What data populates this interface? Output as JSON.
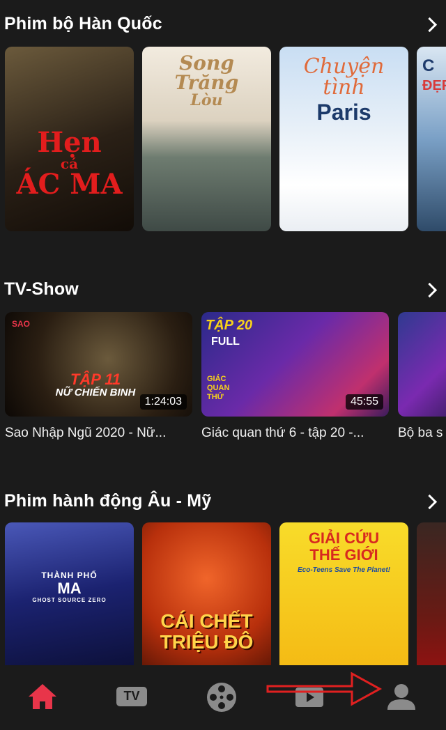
{
  "sections": [
    {
      "title": "Phim bộ Hàn Quốc",
      "cards": [
        {
          "overlay": [
            "Hẹn",
            "cá",
            "ÁC MA"
          ],
          "colors": [
            "#5a4a32",
            "#1d150d"
          ]
        },
        {
          "overlay": [
            "Song",
            "Trăng",
            "Lòu"
          ],
          "colors": [
            "#efe6d6",
            "#6f7d74"
          ]
        },
        {
          "overlay": [
            "Chuyện tình",
            "Paris"
          ],
          "colors": [
            "#cfe2f5",
            "#f2f5fb"
          ]
        },
        {
          "overlay": [
            "C",
            "ĐẸP"
          ],
          "colors": [
            "#7fa3c6",
            "#3c5a78"
          ]
        }
      ]
    },
    {
      "title": "TV-Show",
      "items": [
        {
          "duration": "1:24:03",
          "caption": "Sao Nhập Ngũ 2020 - Nữ...",
          "badge": "SAO",
          "overlay": [
            "TẬP 11",
            "NỮ CHIẾN BINH"
          ],
          "colors": [
            "#3a2d1f",
            "#120c08"
          ]
        },
        {
          "duration": "45:55",
          "caption": "Giác quan thứ 6 - tập 20 -...",
          "badge": "TẬP 20",
          "overlay": [
            "FULL",
            "GIÁC QUAN THỨ"
          ],
          "colors": [
            "#3d2a86",
            "#b0226e"
          ]
        },
        {
          "duration": "",
          "caption": "Bộ ba s",
          "badge": "",
          "overlay": [],
          "colors": [
            "#3b2f7a",
            "#6c2aa0"
          ]
        }
      ]
    },
    {
      "title": "Phim hành động Âu - Mỹ",
      "cards": [
        {
          "overlay": [
            "THÀNH PHỐ",
            "MA",
            "GHOST SOURCE ZERO"
          ],
          "colors": [
            "#2e3a82",
            "#0d1236"
          ]
        },
        {
          "overlay": [
            "CÁI CHẾT",
            "TRIỆU ĐÔ"
          ],
          "colors": [
            "#d8431a",
            "#5a1306"
          ]
        },
        {
          "overlay": [
            "GIẢI CỨU",
            "THẾ GIỚI",
            "Eco-Teens Save The Planet!"
          ],
          "colors": [
            "#f7d21a",
            "#f2a80f"
          ]
        },
        {
          "overlay": [],
          "colors": [
            "#3a2320",
            "#8a1010"
          ]
        }
      ]
    }
  ],
  "nav": {
    "tv_label": "TV",
    "active_color": "#e8354a",
    "inactive_color": "#8b8b8b",
    "icons": [
      "home-icon",
      "tv-icon",
      "film-reel-icon",
      "play-icon",
      "profile-icon"
    ]
  }
}
